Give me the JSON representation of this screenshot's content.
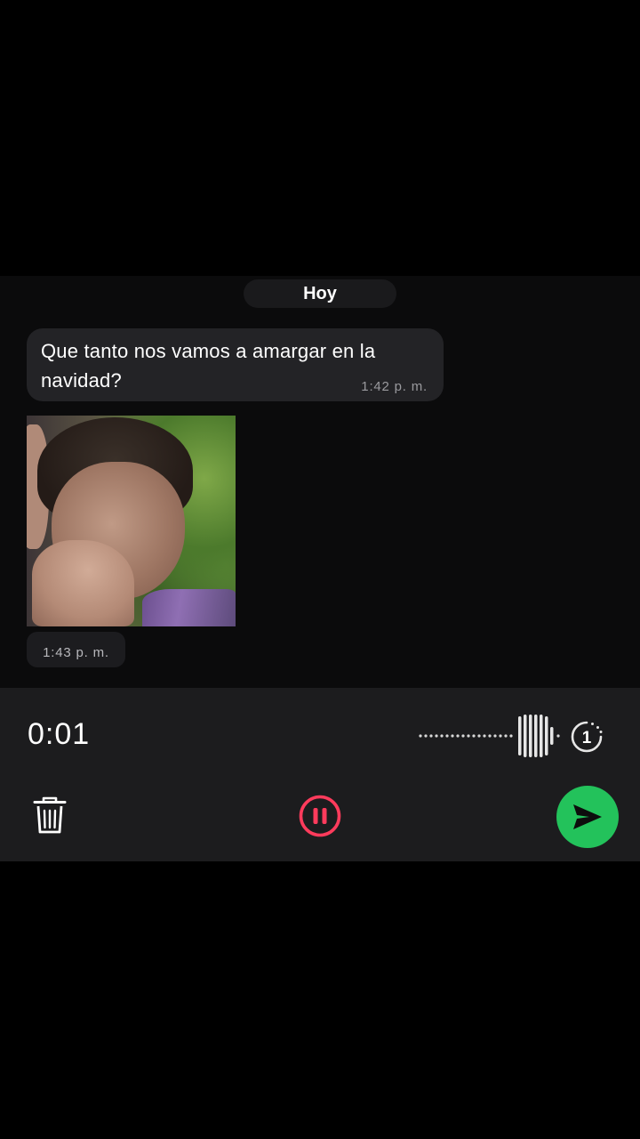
{
  "chat": {
    "date_separator": "Hoy",
    "messages": [
      {
        "type": "text",
        "text": "Que tanto nos vamos a amargar en la navidad?",
        "time": "1:42 p. m."
      },
      {
        "type": "image",
        "time": "1:43 p. m."
      }
    ]
  },
  "recorder": {
    "elapsed": "0:01",
    "view_once_label": "1",
    "icons": {
      "delete": "trash-icon",
      "pause": "pause-icon",
      "send": "send-icon",
      "view_once": "view-once-icon"
    },
    "colors": {
      "pause_accent": "#ff3b5c",
      "send_background": "#23c25b"
    }
  }
}
